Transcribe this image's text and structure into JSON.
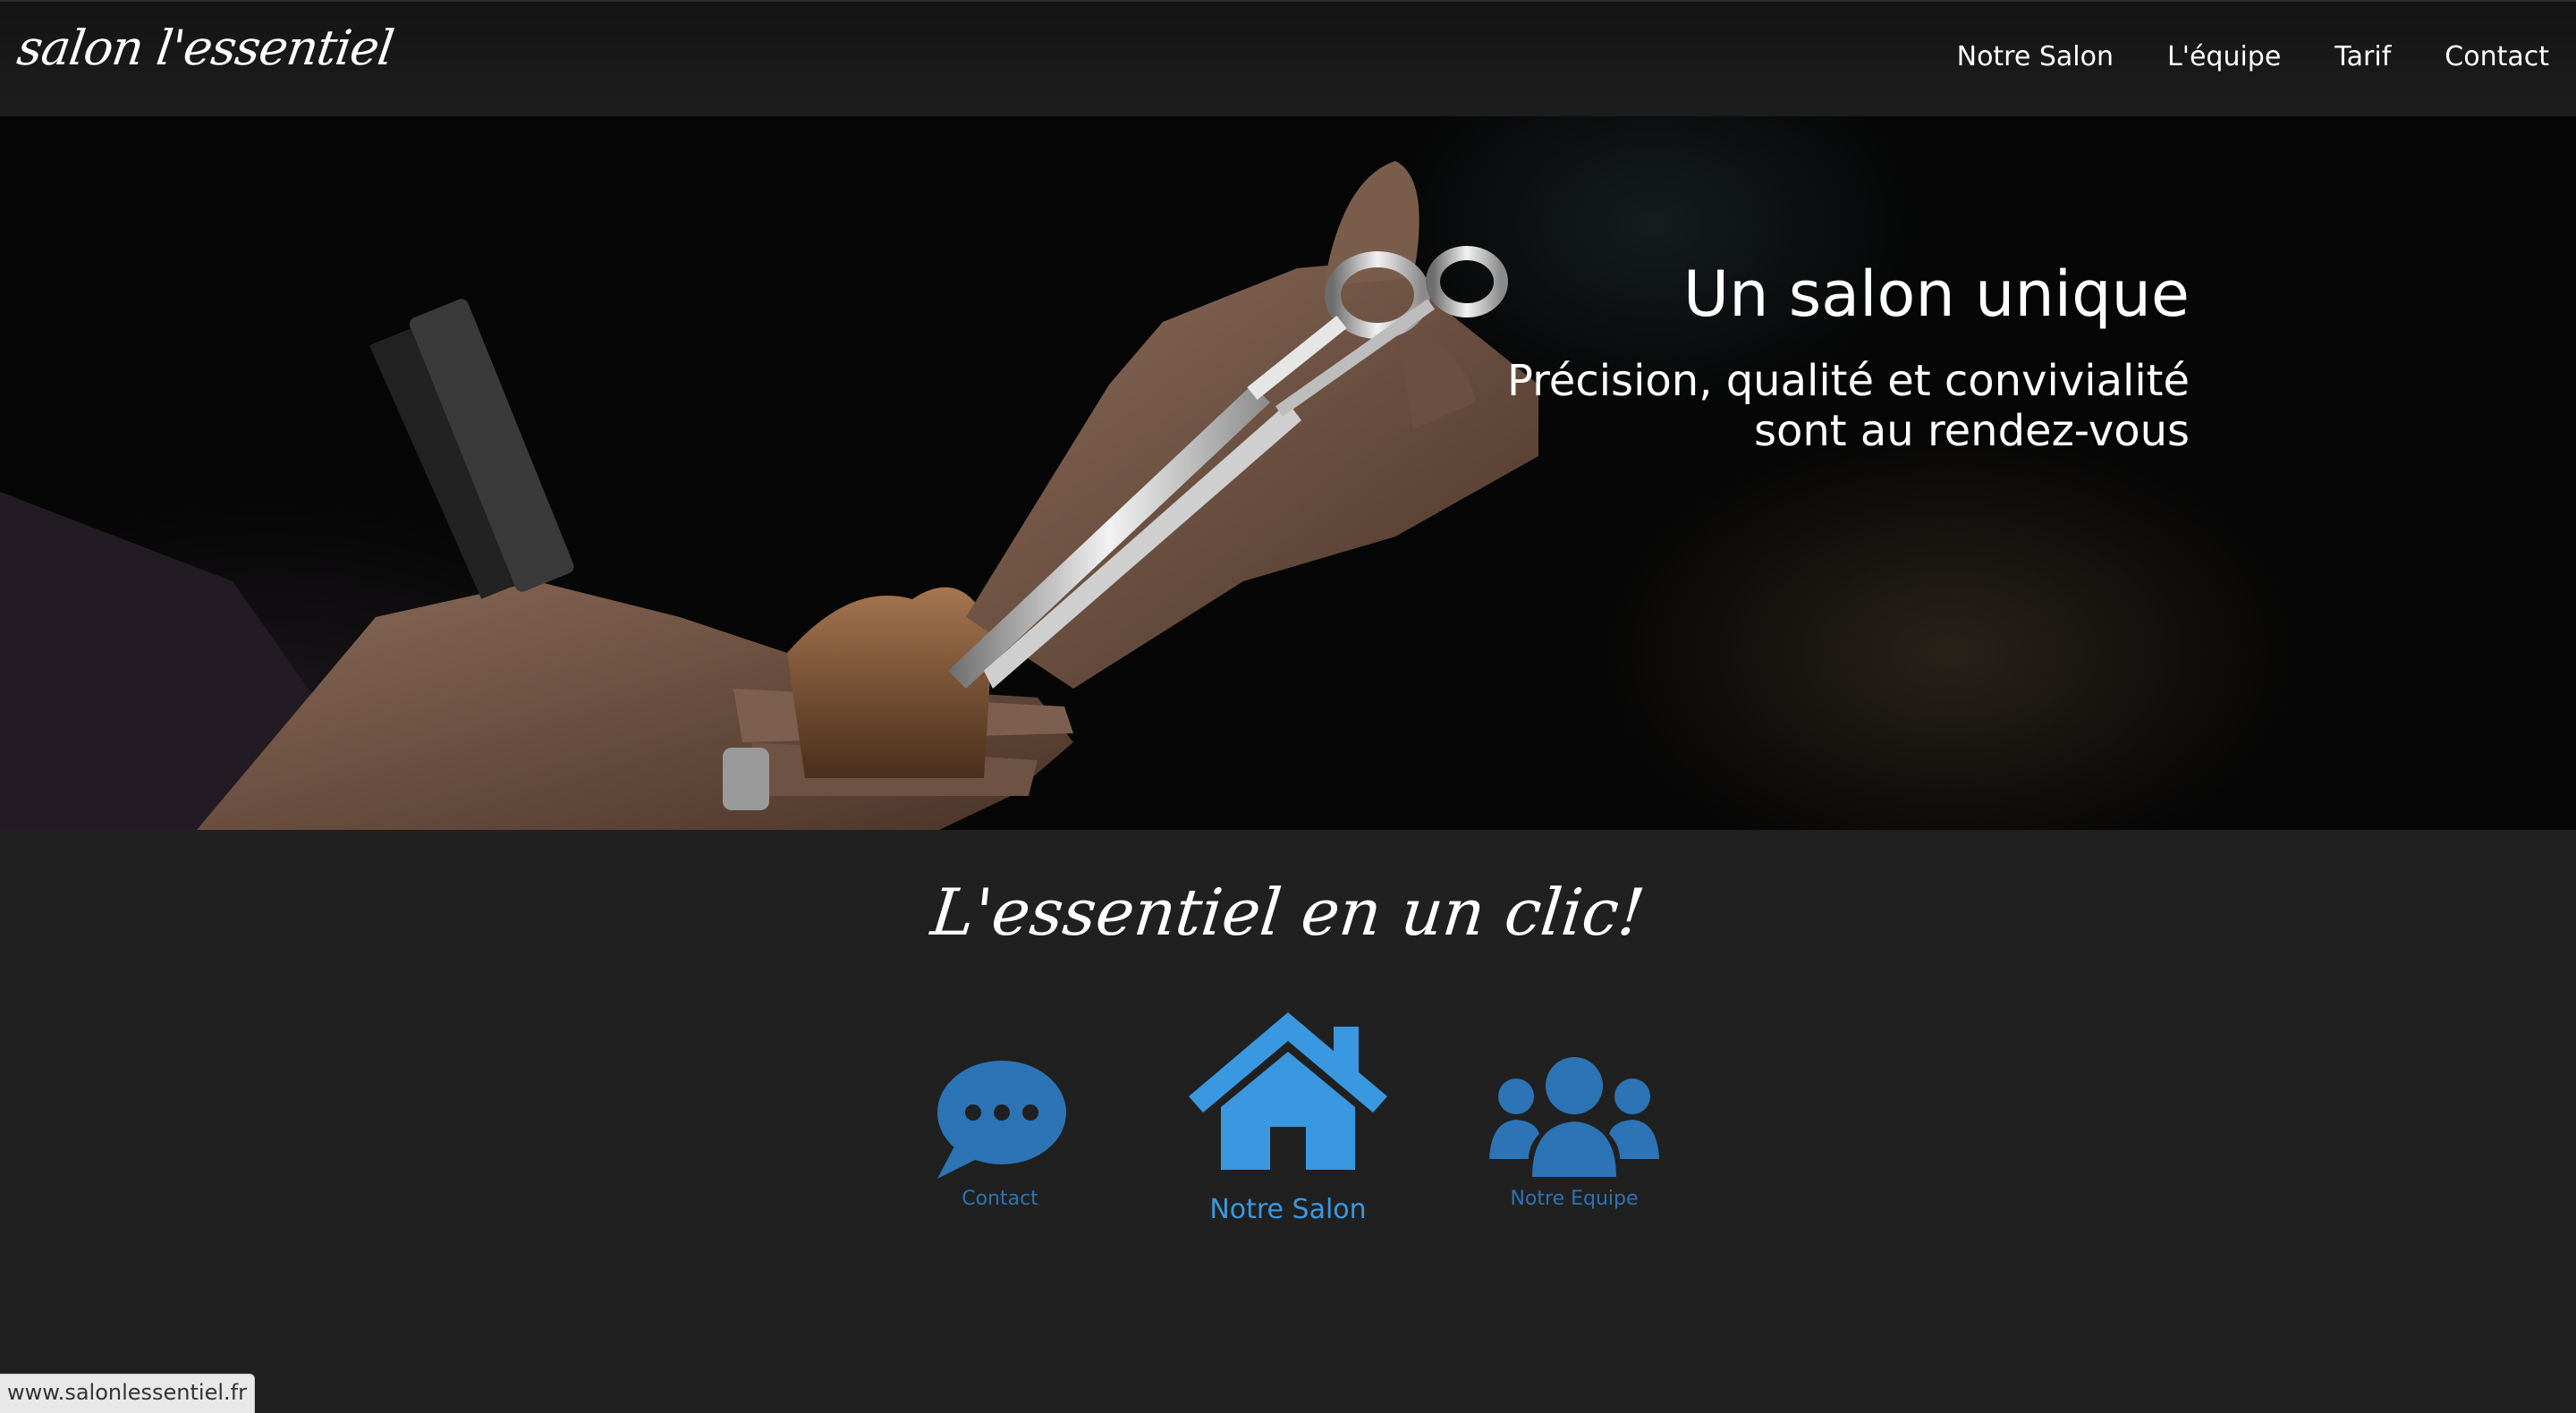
{
  "site": {
    "logo_text": "salon l'essentiel"
  },
  "nav": {
    "items": [
      {
        "label": "Notre Salon"
      },
      {
        "label": "L'équipe"
      },
      {
        "label": "Tarif"
      },
      {
        "label": "Contact"
      }
    ]
  },
  "hero": {
    "title": "Un salon unique",
    "subtitle_line1": "Précision, qualité et convivialité",
    "subtitle_line2": "sont au rendez-vous"
  },
  "quicklinks": {
    "heading": "L'essentiel en un clic!",
    "contact": {
      "label": "Contact",
      "icon": "chat-bubble-icon"
    },
    "salon": {
      "label": "Notre Salon",
      "icon": "house-icon"
    },
    "team": {
      "label": "Notre Equipe",
      "icon": "group-icon"
    }
  },
  "status_bar": {
    "url": "www.salonlessentiel.fr"
  },
  "colors": {
    "header_bg": "#181818",
    "page_bg": "#202020",
    "accent": "#3a98e0",
    "accent_dark": "#2c74b5",
    "text": "#ffffff"
  }
}
